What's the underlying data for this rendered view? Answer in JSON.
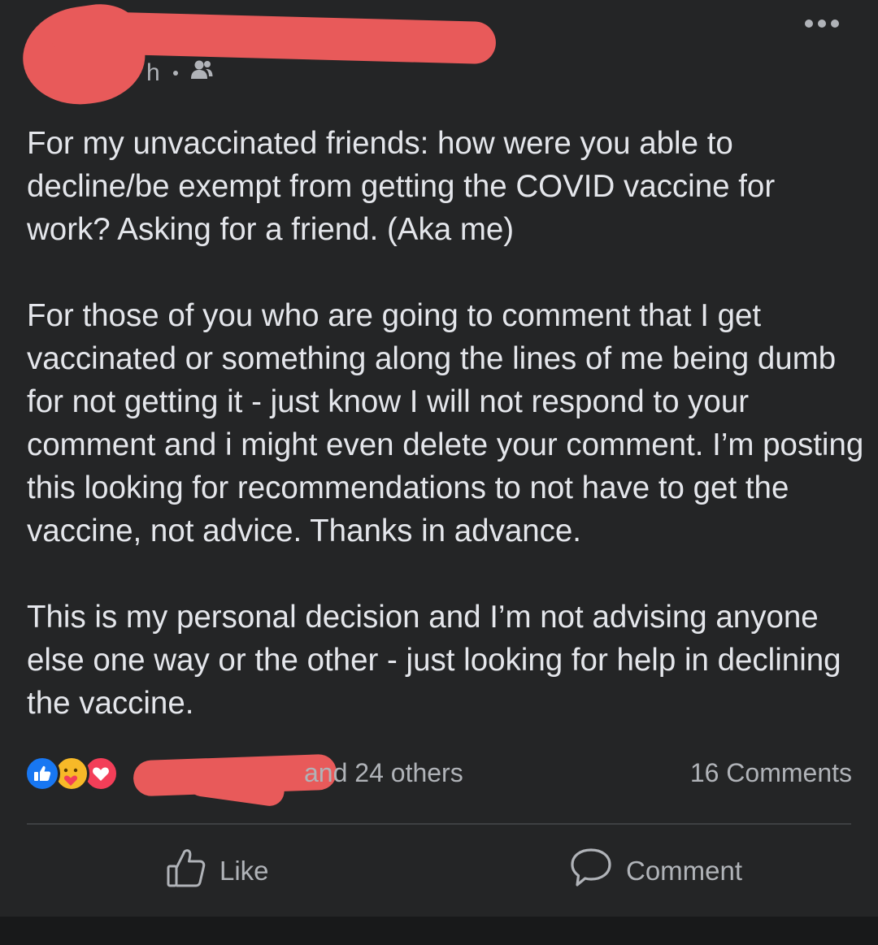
{
  "post": {
    "time_ago": "h",
    "privacy_icon": "friends-icon",
    "more_icon": "more-horizontal-icon",
    "paragraphs": [
      "For my unvaccinated friends: how were you able to decline/be exempt from getting the COVID vaccine for work? Asking for a friend. (Aka me)",
      "For those of you who are going to comment that I get vaccinated or something along the lines of me being dumb for not getting it - just know I will not respond to your comment and i might even delete your comment. I’m posting this looking for recommendations to not have to get the vaccine, not advice. Thanks in advance.",
      "This is my personal decision and I’m not advising anyone else one way or the other - just looking for help in declining the vaccine."
    ]
  },
  "reactions": {
    "icons": [
      "like-reaction-icon",
      "care-reaction-icon",
      "love-reaction-icon"
    ],
    "summary": "and 24 others",
    "comments": "16 Comments"
  },
  "actions": {
    "like_label": "Like",
    "comment_label": "Comment"
  },
  "colors": {
    "background": "#242526",
    "text": "#e4e6eb",
    "muted": "#b0b3b8",
    "redaction": "#e85a5a",
    "like_blue": "#1877f2",
    "love_red": "#f33e58",
    "care_yellow": "#f7b928"
  }
}
